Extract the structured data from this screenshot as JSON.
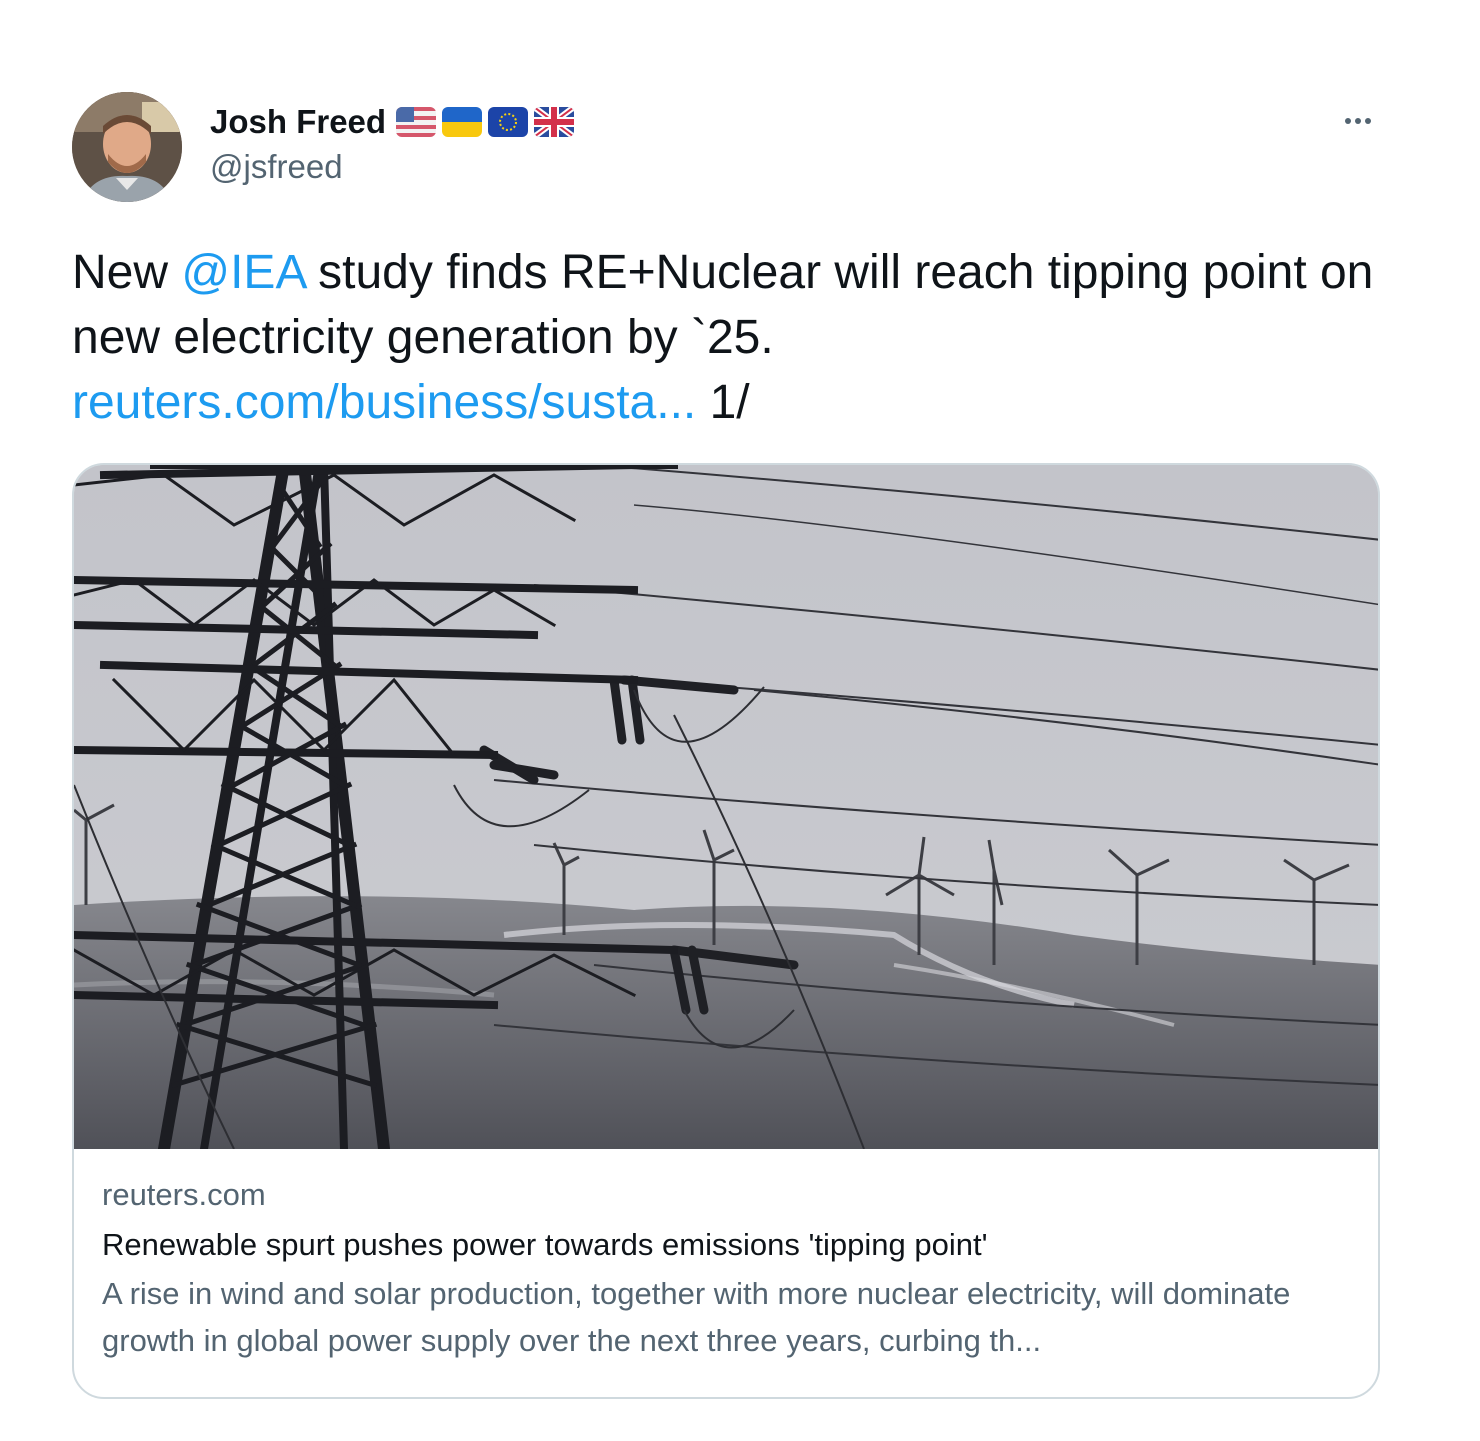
{
  "author": {
    "display_name": "Josh Freed",
    "handle": "@jsfreed",
    "flags": [
      "us-flag-icon",
      "ukraine-flag-icon",
      "eu-flag-icon",
      "uk-flag-icon"
    ]
  },
  "tweet": {
    "text_before_mention": "New ",
    "mention": "@IEA",
    "text_after_mention": " study finds RE+Nuclear will reach tipping point on new electricity generation by `25.",
    "link_text": "reuters.com/business/susta...",
    "text_after_link": " 1/"
  },
  "card": {
    "domain": "reuters.com",
    "title": "Renewable spurt pushes power towards emissions 'tipping point'",
    "description": "A rise in wind and solar production, together with more nuclear electricity, will dominate growth in global power supply over the next three years, curbing th..."
  },
  "colors": {
    "link": "#1d9bf0",
    "text": "#0f1419",
    "secondary": "#536471",
    "border": "#cfd9de"
  }
}
